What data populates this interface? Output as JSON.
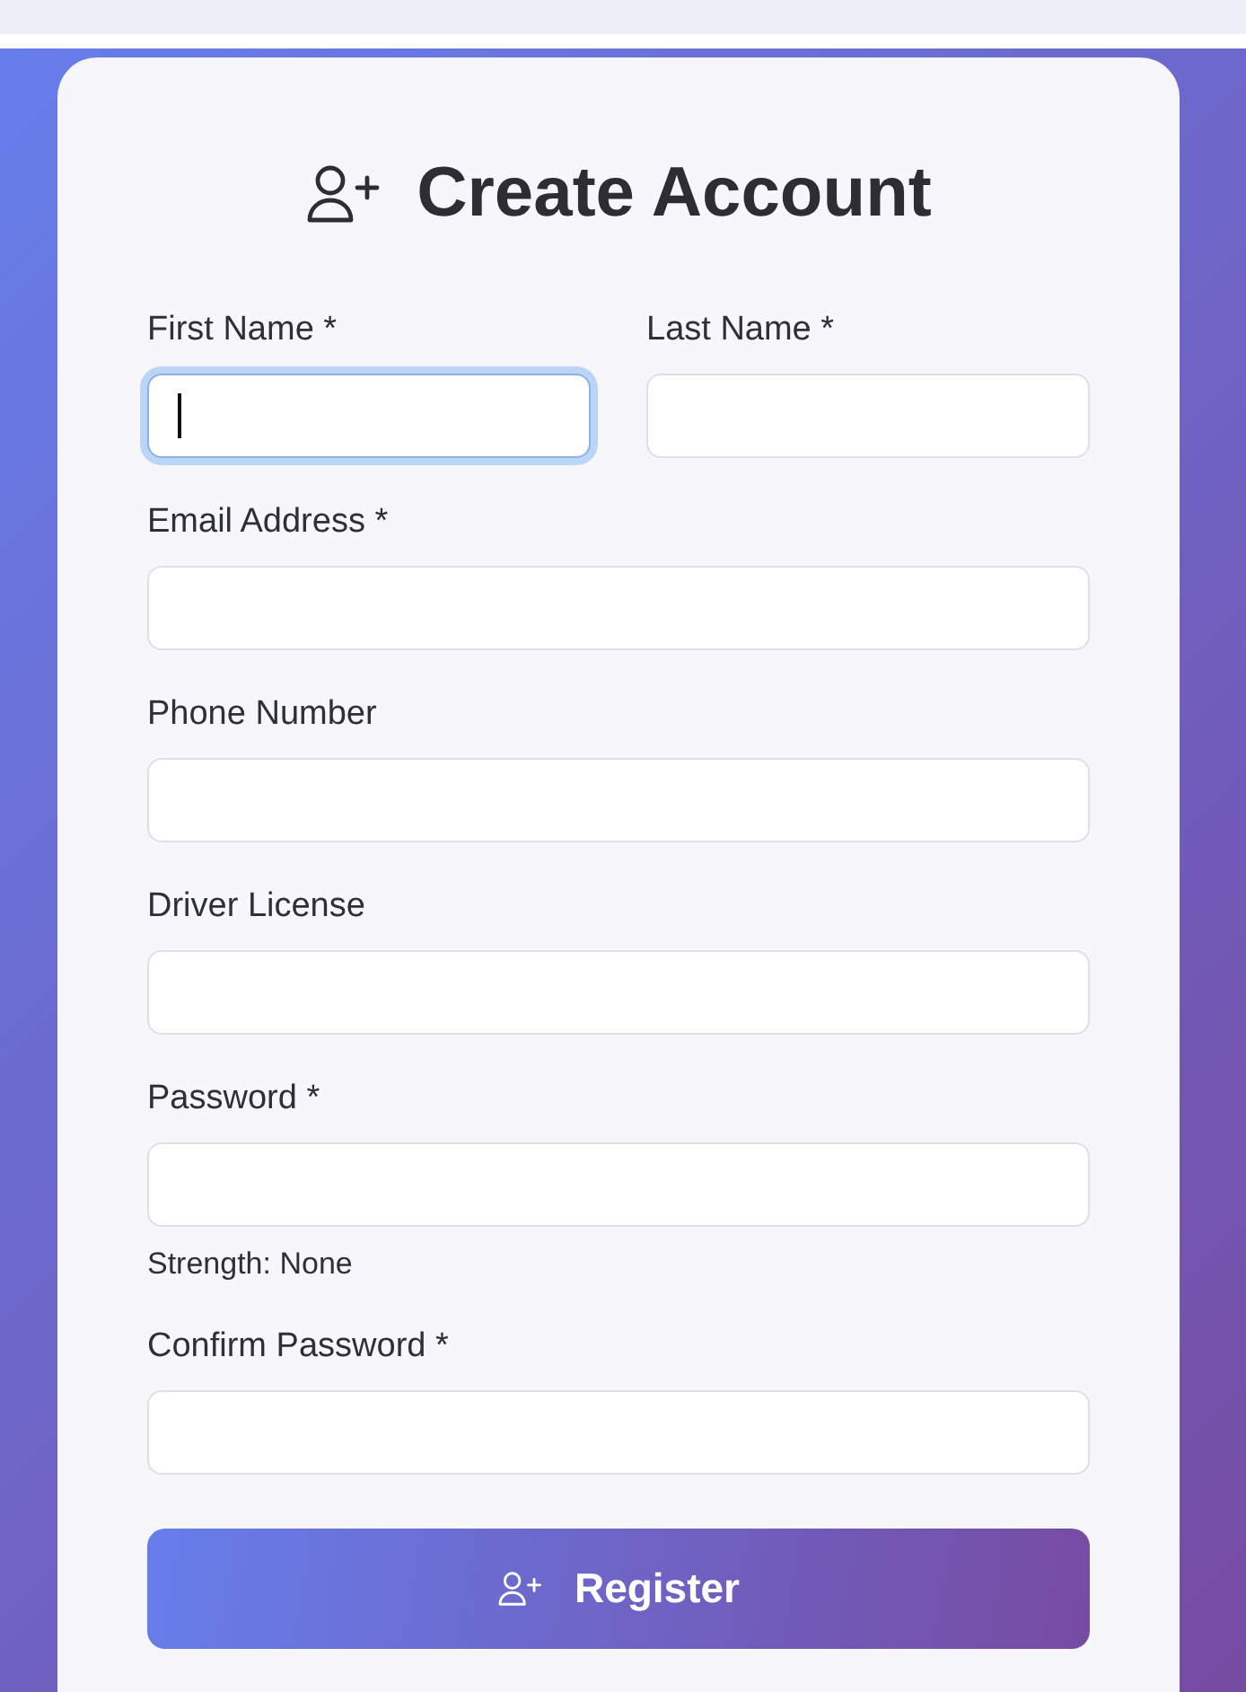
{
  "title": {
    "text": "Create Account"
  },
  "form": {
    "rows": [
      {
        "fields": [
          {
            "label": "First Name *",
            "focused": true
          },
          {
            "label": "Last Name *",
            "focused": false
          }
        ]
      },
      {
        "fields": [
          {
            "label": "Email Address *",
            "focused": false
          }
        ]
      },
      {
        "fields": [
          {
            "label": "Phone Number",
            "focused": false
          }
        ]
      },
      {
        "fields": [
          {
            "label": "Driver License",
            "focused": false
          }
        ]
      },
      {
        "fields": [
          {
            "label": "Password *",
            "focused": false,
            "hint": "Strength: None"
          }
        ]
      },
      {
        "fields": [
          {
            "label": "Confirm Password *",
            "focused": false
          }
        ]
      }
    ]
  },
  "submit_button": {
    "label": "Register"
  }
}
